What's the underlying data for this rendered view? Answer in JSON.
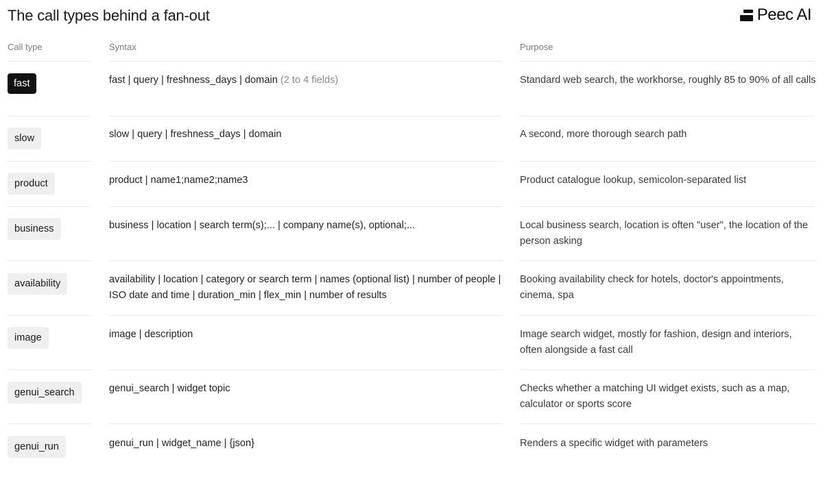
{
  "title": "The call types behind a fan-out",
  "brand": {
    "name": "Peec AI",
    "icon": "peec-logo-icon"
  },
  "headers": {
    "call_type": "Call type",
    "syntax": "Syntax",
    "purpose": "Purpose"
  },
  "rows": [
    {
      "type": "fast",
      "syntax": "fast | query | freshness_days | domain",
      "note": "(2 to 4 fields)",
      "purpose": "Standard web search, the workhorse, roughly 85 to 90% of all calls",
      "active": true
    },
    {
      "type": "slow",
      "syntax": "slow | query | freshness_days | domain",
      "note": "",
      "purpose": "A second, more thorough search path"
    },
    {
      "type": "product",
      "syntax": "product | name1;name2;name3",
      "note": "",
      "purpose": "Product catalogue lookup, semicolon-separated list"
    },
    {
      "type": "business",
      "syntax": "business | location | search term(s);... | company name(s), optional;...",
      "note": "",
      "purpose": "Local business search, location is often \"user\", the location of the person asking"
    },
    {
      "type": "availability",
      "syntax": "availability | location | category or search term | names (optional list) | number of people | ISO date and time | duration_min | flex_min | number of results",
      "note": "",
      "purpose": "Booking availability check for hotels, doctor's appointments, cinema, spa"
    },
    {
      "type": "image",
      "syntax": "image | description",
      "note": "",
      "purpose": "Image search widget, mostly for fashion, design and interiors, often alongside a fast call"
    },
    {
      "type": "genui_search",
      "syntax": "genui_search | widget topic",
      "note": "",
      "purpose": "Checks whether a matching UI widget exists, such as a map, calculator or sports score"
    },
    {
      "type": "genui_run",
      "syntax": "genui_run | widget_name | {json}",
      "note": "",
      "purpose": "Renders a specific widget with parameters"
    }
  ]
}
